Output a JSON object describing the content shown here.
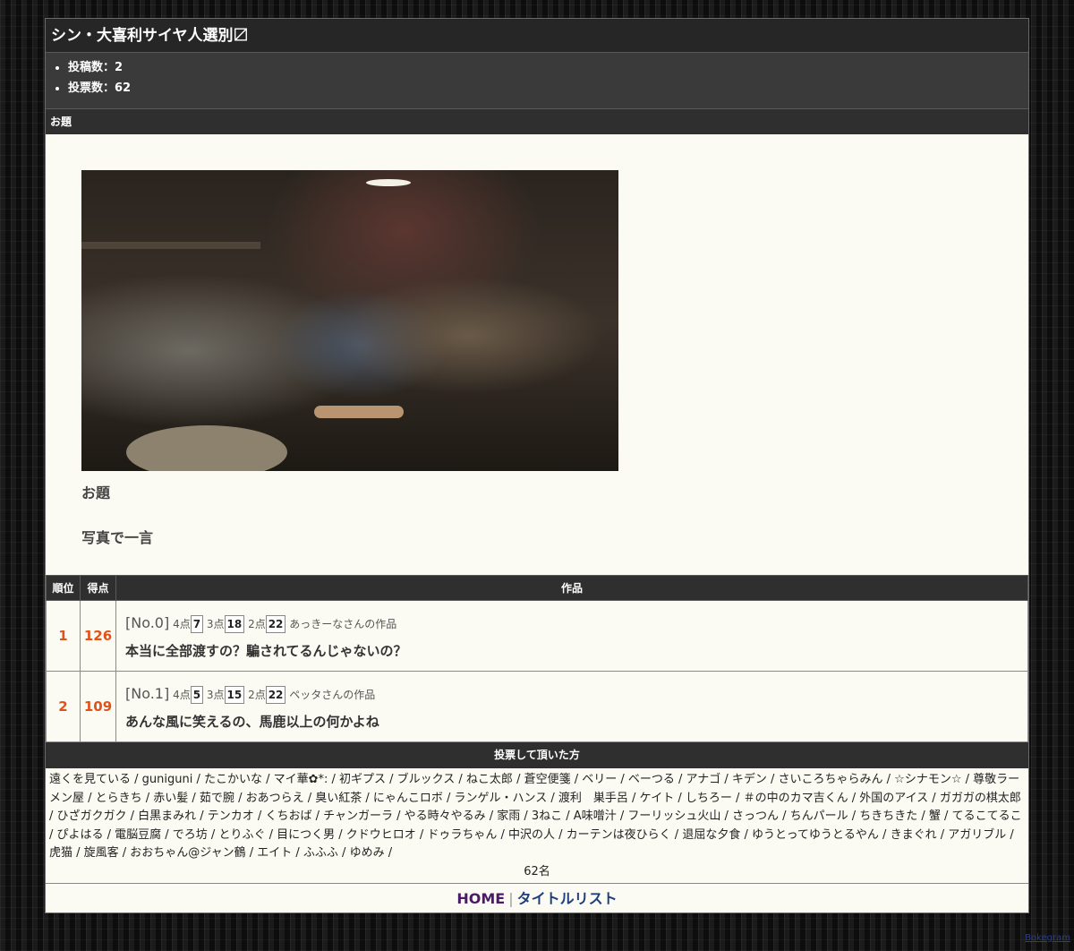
{
  "title": "シン・大喜利サイヤ人選別〼",
  "stats": [
    "投稿数：2",
    "投票数：62"
  ],
  "odai_head": "お題",
  "odai": {
    "label": "お題",
    "text": "写真で一言"
  },
  "table": {
    "headers": [
      "順位",
      "得点",
      "作品"
    ],
    "rows": [
      {
        "rank": "1",
        "score": "126",
        "no": "[No.0]",
        "p4_label": "4点",
        "p4": "7",
        "p3_label": "3点",
        "p3": "18",
        "p2_label": "2点",
        "p2": "22",
        "author": "あっきーなさんの作品",
        "caption": "本当に全部渡すの？騙されてるんじゃないの？"
      },
      {
        "rank": "2",
        "score": "109",
        "no": "[No.1]",
        "p4_label": "4点",
        "p4": "5",
        "p3_label": "3点",
        "p3": "15",
        "p2_label": "2点",
        "p2": "22",
        "author": "ペッタさんの作品",
        "caption": "あんな風に笑えるの、馬鹿以上の何かよね"
      }
    ]
  },
  "voters": {
    "head": "投票して頂いた方",
    "list": "遠くを見ている / guniguni / たこかいな / マイ華✿*: / 初ギプス / ブルックス / ねこ太郎 / 蒼空便箋 / ベリー / ベーつる / アナゴ / キデン / さいころちゃらみん / ☆シナモン☆ / 尊敬ラーメン屋 / とらきち / 赤い髪 / 茹で腕 / おあつらえ / 臭い紅茶 / にゃんこロボ / ランゲル・ハンス / 渡利　巣手呂 / ケイト / しちろー / ＃の中のカマ吉くん / 外国のアイス / ガガガの棋太郎 / ひざガクガク / 白黒まみれ / テンカオ / くちおば / チャンガーラ / やる時々やるみ / 家雨 / 3ねこ / A味噌汁 / フーリッシュ火山 / さっつん / ちんパール / ちきちきた / 蟹 / てるこてるこ / ぴよはる / 電脳豆腐 / でろ坊 / とりふぐ / 目につく男 / クドウヒロオ / ドゥラちゃん / 中沢の人 / カーテンは夜ひらく / 退屈な夕食 / ゆうとってゆうとるやん / きまぐれ / アガリブル / 虎猫 / 旋風客 / おおちゃん@ジャン鶴 / エイト / ふふふ / ゆめみ /",
    "count": "62名"
  },
  "footer": {
    "home": "HOME",
    "separator": "|",
    "title_list": "タイトルリスト"
  },
  "credit": "Bokegram",
  "colors": {
    "score_orange": "#e0521c",
    "header_dark": "#262626",
    "content_bg": "#fcfbf3",
    "home_link": "#4b1a6b",
    "list_link": "#1f3f7a"
  }
}
